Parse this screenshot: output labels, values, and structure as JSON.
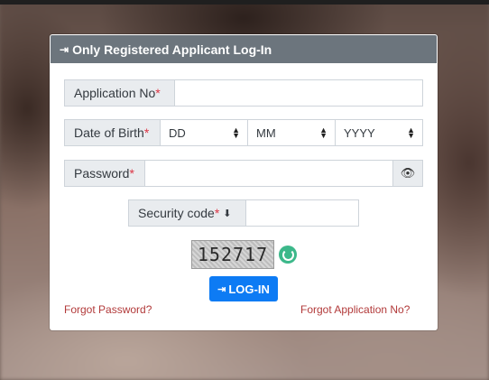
{
  "header": {
    "icon": "sign-in-icon",
    "title": "Only Registered Applicant Log-In"
  },
  "form": {
    "application_no_label": "Application No",
    "dob_label": "Date of Birth",
    "dob_day": "DD",
    "dob_month": "MM",
    "dob_year": "YYYY",
    "password_label": "Password",
    "security_code_label": "Security code",
    "required_mark": "*"
  },
  "captcha": {
    "code": "152717"
  },
  "buttons": {
    "login_label": "LOG-IN"
  },
  "links": {
    "forgot_password": "Forgot Password?",
    "forgot_application": "Forgot Application No?"
  },
  "colors": {
    "header_bg": "#6c757d",
    "primary": "#0d7bf4",
    "link": "#b23a3a",
    "required": "#dc3545",
    "refresh": "#3cb88a"
  }
}
